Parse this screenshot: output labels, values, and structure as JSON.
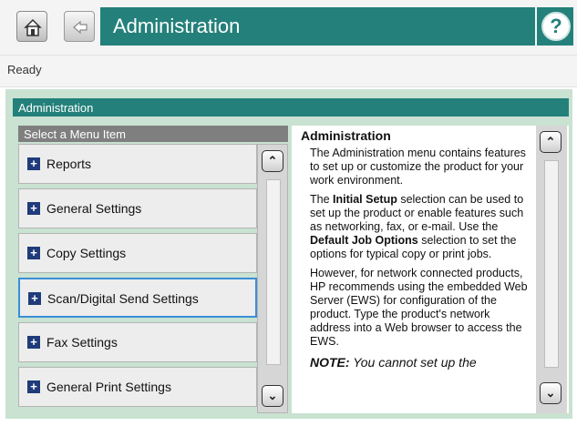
{
  "header": {
    "title": "Administration",
    "home_icon": "home-icon",
    "back_icon": "back-arrow-icon",
    "help_symbol": "?",
    "accent_color": "#24807a"
  },
  "status": {
    "text": "Ready"
  },
  "panel": {
    "title": "Administration",
    "list_header": "Select a Menu Item",
    "menu_items": [
      {
        "label": "Reports"
      },
      {
        "label": "General Settings"
      },
      {
        "label": "Copy Settings"
      },
      {
        "label": "Scan/Digital Send Settings",
        "selected": true
      },
      {
        "label": "Fax Settings"
      },
      {
        "label": "General Print Settings"
      }
    ],
    "scroll_up_glyph": "⌃",
    "scroll_down_glyph": "⌄"
  },
  "help": {
    "title": "Administration",
    "p1": "The Administration menu contains features to set up or customize the product for your work environment.",
    "p2_a": "The ",
    "p2_b": "Initial Setup",
    "p2_c": " selection can be used to set up the product or enable features such as networking, fax, or e-mail. Use the ",
    "p2_d": "Default Job Options",
    "p2_e": " selection to set the options for typical copy or print jobs.",
    "p3": "However, for network connected products, HP recommends using the embedded Web Server (EWS) for configuration of the product. Type the product's network address into a Web browser to access the EWS.",
    "note_label": "NOTE:",
    "note_text": " You cannot set up the"
  }
}
